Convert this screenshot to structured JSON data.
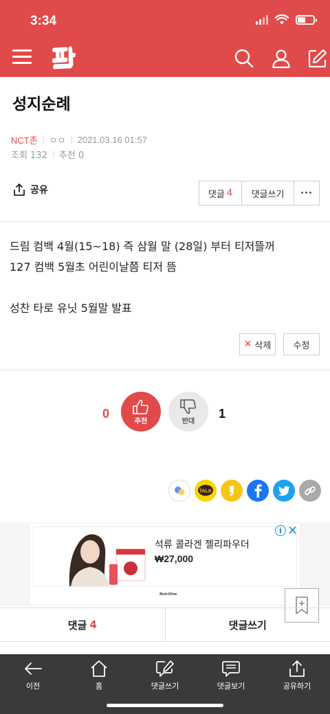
{
  "status_bar": {
    "time": "3:34"
  },
  "header": {
    "logo_text": "판",
    "icons": [
      "menu-icon",
      "search-icon",
      "user-icon",
      "write-icon"
    ],
    "accent_color": "#e14a4a"
  },
  "post": {
    "title": "성지순례",
    "board": "NCT존",
    "author": "ㅇㅇ",
    "datetime": "2021.03.16 01:57",
    "views": "조회 132",
    "recommends": "추천 0",
    "lines": [
      "드림 컴백 4월(15~18) 즉 삼월 말 (28일) 부터 티저뜰꺼",
      "127 컴백 5월초 어린이날쯤 티저 뜸",
      "",
      "성찬 타로 유닛 5월말 발표"
    ]
  },
  "actions": {
    "share_label": "공유",
    "comments_label": "댓글",
    "comments_count": "4",
    "write_comment_label": "댓글쓰기",
    "more_label": "···",
    "delete_label": "삭제",
    "edit_label": "수정"
  },
  "vote": {
    "up_count": "0",
    "up_label": "추천",
    "down_label": "반대",
    "down_count": "1"
  },
  "sns": [
    "kakaostory-icon",
    "kakaotalk-icon",
    "kakao-channel-icon",
    "facebook-icon",
    "twitter-icon",
    "link-icon"
  ],
  "ad": {
    "title": "석류 콜라겐 젤리파우더",
    "price": "₩27,000",
    "brand": "NutriOne",
    "info": "i",
    "close": "✕"
  },
  "bottom_actions": {
    "comments_label": "댓글",
    "comments_count": "4",
    "write_label": "댓글쓰기"
  },
  "tabbar": {
    "items": [
      {
        "label": "이전",
        "icon": "arrow-left-icon"
      },
      {
        "label": "홈",
        "icon": "home-icon"
      },
      {
        "label": "댓글쓰기",
        "icon": "comment-write-icon"
      },
      {
        "label": "댓글보기",
        "icon": "comment-view-icon"
      },
      {
        "label": "공유하기",
        "icon": "share-icon"
      }
    ]
  }
}
